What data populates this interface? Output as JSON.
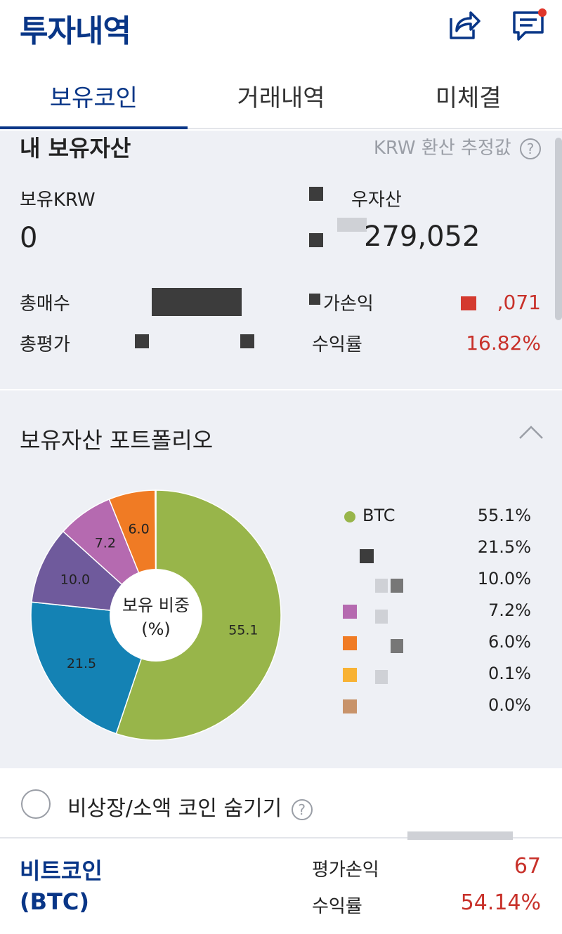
{
  "header": {
    "title": "투자내역",
    "icons": [
      "share-icon",
      "message-icon"
    ],
    "notification_color": "#e0372b"
  },
  "tabs": [
    {
      "label": "보유코인",
      "active": true
    },
    {
      "label": "거래내역",
      "active": false
    },
    {
      "label": "미체결",
      "active": false
    }
  ],
  "summary": {
    "title": "내 보유자산",
    "krw_note": "KRW 환산 추정값",
    "held_krw_label": "보유KRW",
    "held_krw_value": "0",
    "total_assets_label": "우자산",
    "total_assets_value": "279,052",
    "total_buy_label": "총매수",
    "total_eval_label": "총평가",
    "pnl_label": "가손익",
    "pnl_value": ",071",
    "return_label": "수익률",
    "return_value": "16.82%"
  },
  "portfolio": {
    "title": "보유자산 포트폴리오",
    "center_label_1": "보유 비중",
    "center_label_2": "(%)"
  },
  "chart_data": {
    "type": "pie",
    "categories": [
      "BTC",
      "",
      "",
      "",
      "",
      "",
      ""
    ],
    "values": [
      55.1,
      21.5,
      10.0,
      7.2,
      6.0,
      0.1,
      0.0
    ],
    "slice_labels": [
      "55.1",
      "21.5",
      "10.0",
      "7.2",
      "6.0",
      "",
      ""
    ],
    "legend_pct": [
      "55.1%",
      "21.5%",
      "10.0%",
      "7.2%",
      "6.0%",
      "0.1%",
      "0.0%"
    ],
    "colors": [
      "#98b54a",
      "#1482b4",
      "#6f5a9c",
      "#b56ab0",
      "#f07b24",
      "#f8b233",
      "#c8936a"
    ],
    "center_text": "보유 비중 (%)",
    "legend_placement": "right"
  },
  "hide_option": {
    "label": "비상장/소액 코인 숨기기"
  },
  "coin": {
    "name": "비트코인",
    "symbol": "(BTC)",
    "pnl_label": "평가손익",
    "pnl_value": "67",
    "return_label": "수익률",
    "return_value": "54.14%"
  }
}
